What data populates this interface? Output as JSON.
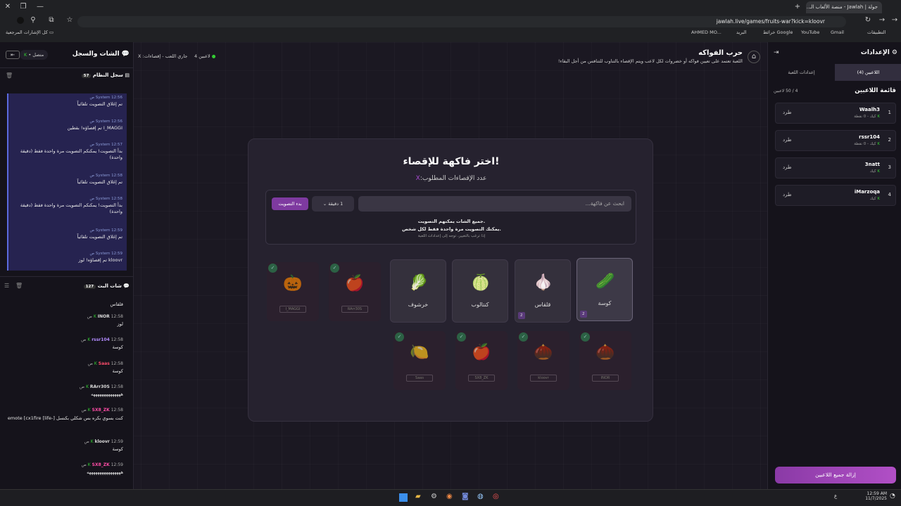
{
  "browser": {
    "tab_title": "جولة | Jawlah - منصة الألعاب الـ...",
    "url": "jawlah.live/games/fruits-war?kick=kloovr",
    "bookmarks": [
      "التطبيقات",
      "Gmail",
      "YouTube",
      "خرائط Google",
      "البريد",
      "AHMED MO..."
    ],
    "bookmark_folder": "كل الإشارات المرجعية"
  },
  "chat_panel": {
    "title": "الشات والسجل",
    "status": "متصل",
    "system_log": {
      "title": "سجل النظام",
      "count": "57",
      "entries": [
        {
          "author": "System",
          "time": "12:56 ص",
          "text": "تم إغلاق التصويت تلقائياً"
        },
        {
          "author": "System",
          "time": "12:56 ص",
          "text": "I_MAGGI تم إقصاؤه! بقطين"
        },
        {
          "author": "System",
          "time": "12:57 ص",
          "text": "بدأ التصويت! يمكنكم التصويت مرة واحدة فقط (دقيقة واحدة)"
        },
        {
          "author": "System",
          "time": "12:58 ص",
          "text": "تم إغلاق التصويت تلقائياً"
        },
        {
          "author": "System",
          "time": "12:58 ص",
          "text": "بدأ التصويت! يمكنكم التصويت مرة واحدة فقط (دقيقة واحدة)"
        },
        {
          "author": "System",
          "time": "12:59 ص",
          "text": "تم إغلاق التصويت تلقائياً"
        },
        {
          "author": "System",
          "time": "12:59 ص",
          "text": "kloovr تم إقصاؤه! لوز"
        }
      ]
    },
    "live_chat": {
      "title": "شات البث",
      "count": "127",
      "first_line": "قلقاس",
      "messages": [
        {
          "author": "INOR",
          "time": "12:58 ص",
          "text": "لوز",
          "color": "#dddddd"
        },
        {
          "author": "rssr104",
          "time": "12:58 ص",
          "text": "كوسة",
          "color": "#b38cff"
        },
        {
          "author": "Saas",
          "time": "12:58 ص",
          "text": "كوسة",
          "color": "#ff4d6d"
        },
        {
          "author": "RArr30S",
          "time": "12:58 ص",
          "text": "ههههههههههههههه",
          "color": "#dddddd"
        },
        {
          "author": "SX8_ZK",
          "time": "12:58 ص",
          "text": "كنت بسوي بكره بس شكلي بكنسل [-life] emote [cx1fire",
          "color": "#ff4da6"
        },
        {
          "author": "kloovr",
          "time": "12:59 ص",
          "text": "كوسة",
          "color": "#dddddd"
        },
        {
          "author": "SX8_ZK",
          "time": "12:59 ص",
          "text": "ههههههههههههههههه",
          "color": "#ff4da6"
        }
      ]
    }
  },
  "header": {
    "title": "حرب الفواكه",
    "subtitle": "اللعبة تعتمد على تعيين فواكه أو خضروات لكل لاعب ويتم الإقصاء بالتناوب للتنافس من أجل البقاء!",
    "players_count": "4 لاعبين",
    "status": "جاري اللعب - إقصاءات: X"
  },
  "vote_card": {
    "title": "اختر فاكهة للإقصاء!",
    "required": "عدد الإقصاءات المطلوب:",
    "required_value": "X",
    "search_placeholder": "ابحث عن فاكهة...",
    "duration": "1 دقيقة",
    "start_vote": "بدء التصويت",
    "info1": "جميع الشات يمكنهم التصويت.",
    "info2": "يمكنك التصويت مرة واحدة فقط لكل شخص.",
    "info3": "إذا ترغب بالتغيير، توجه إلى إعدادات اللعبة",
    "fruits": [
      {
        "name": "كوسة",
        "icon": "🥒",
        "votes": "2"
      },
      {
        "name": "قلقاس",
        "icon": "🧄",
        "votes": "2"
      },
      {
        "name": "كنتالوب",
        "icon": "🍈",
        "votes": ""
      },
      {
        "name": "خرشوف",
        "icon": "🥬",
        "votes": ""
      }
    ],
    "eliminated_top": [
      {
        "player": "RArr30S",
        "icon": "🍎"
      },
      {
        "player": "I_MAGGI",
        "icon": "🎃"
      }
    ],
    "eliminated_bottom": [
      {
        "player": "INOR",
        "icon": "🌰"
      },
      {
        "player": "kloovr",
        "icon": "🌰"
      },
      {
        "player": "SX8_ZK",
        "icon": "🍎"
      },
      {
        "player": "Saas",
        "icon": "🍋"
      }
    ]
  },
  "settings_panel": {
    "title": "الإعدادات",
    "tab_players": "اللاعبين (4)",
    "tab_game": "إعدادات اللعبة",
    "list_title": "قائمة اللاعبين",
    "limit": "4 / 50 لاعبين",
    "kick": "طرد",
    "players": [
      {
        "rank": "1",
        "name": "Waalh3",
        "sub": "كيك - 0 نقطة"
      },
      {
        "rank": "2",
        "name": "rssr104",
        "sub": "كيك - 0 نقطة"
      },
      {
        "rank": "3",
        "name": "3natt",
        "sub": "كيك"
      },
      {
        "rank": "4",
        "name": "iMarzoqa",
        "sub": "كيك"
      }
    ],
    "remove_all": "إزالة جميع اللاعبين"
  },
  "taskbar": {
    "time": "12:59 AM",
    "date": "11/7/2025",
    "lang": "ع"
  }
}
